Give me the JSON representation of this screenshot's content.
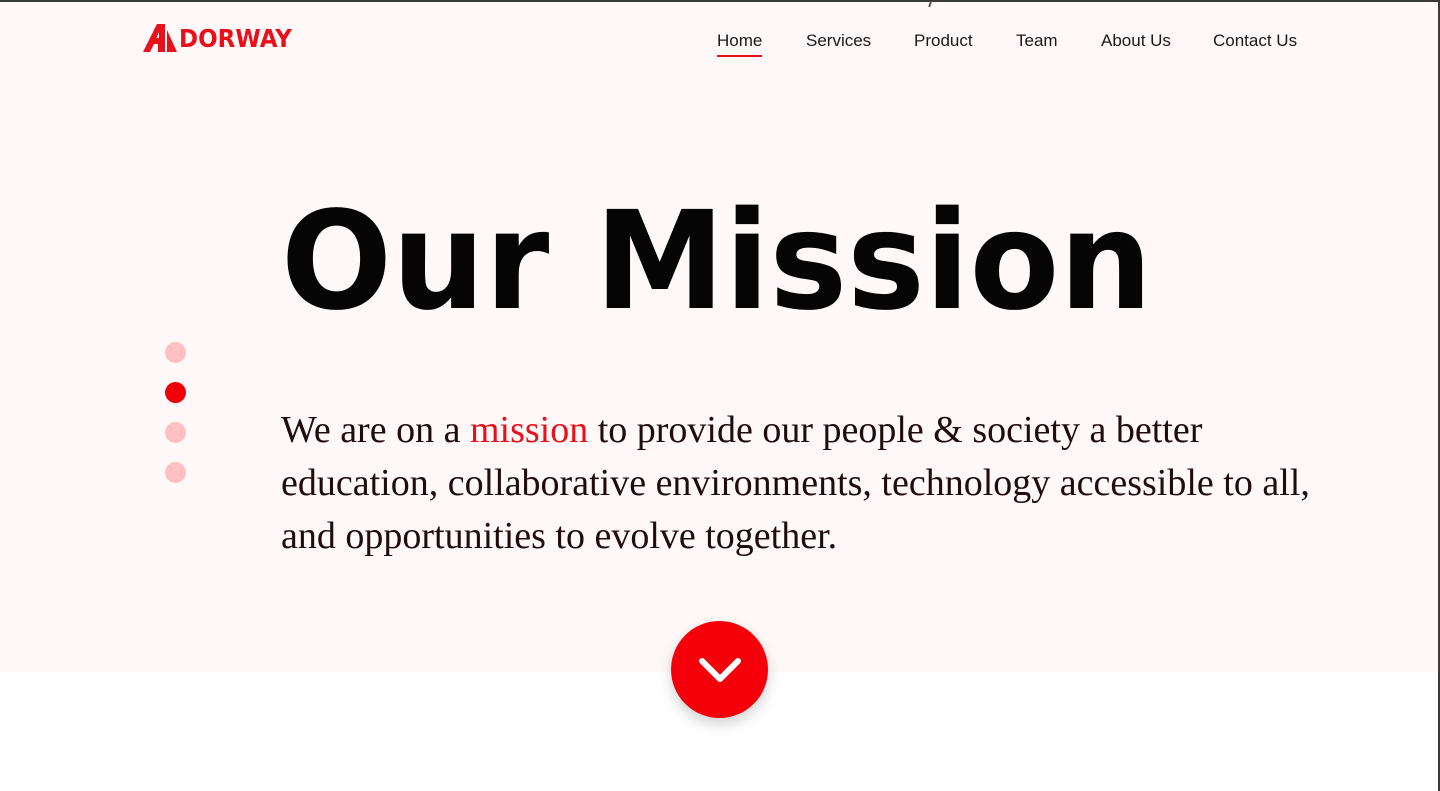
{
  "brand": {
    "logo_text": "DORWAY",
    "logo_letter": "A",
    "accent_color": "#e8101a"
  },
  "nav": {
    "items": [
      {
        "label": "Home",
        "active": true
      },
      {
        "label": "Services",
        "active": false
      },
      {
        "label": "Product",
        "active": false
      },
      {
        "label": "Team",
        "active": false
      },
      {
        "label": "About Us",
        "active": false
      },
      {
        "label": "Contact Us",
        "active": false
      }
    ]
  },
  "hero": {
    "title": "Our Mission",
    "text_before": "We are on a ",
    "text_highlight": "mission",
    "text_after": " to provide our people & society a better education, collaborative environments, technology accessible to all, and opportunities to evolve together.",
    "background_color": "#fff8f8"
  },
  "pagination": {
    "count": 4,
    "active_index": 1,
    "active_color": "#f0000a",
    "inactive_color": "#ffc0c4"
  },
  "scroll_button": {
    "icon": "chevron-down-icon",
    "color": "#f5000a"
  }
}
